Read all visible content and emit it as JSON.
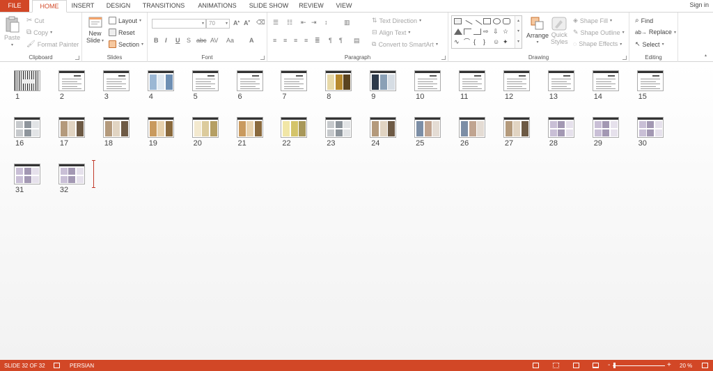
{
  "tabs": [
    "FILE",
    "HOME",
    "INSERT",
    "DESIGN",
    "TRANSITIONS",
    "ANIMATIONS",
    "SLIDE SHOW",
    "REVIEW",
    "VIEW"
  ],
  "active_tab": "HOME",
  "signin": "Sign in",
  "ribbon": {
    "clipboard": {
      "label": "Clipboard",
      "paste": "Paste",
      "cut": "Cut",
      "copy": "Copy",
      "format_painter": "Format Painter"
    },
    "slides": {
      "label": "Slides",
      "new_slide_1": "New",
      "new_slide_2": "Slide",
      "layout": "Layout",
      "reset": "Reset",
      "section": "Section"
    },
    "font": {
      "label": "Font",
      "font_size": "70"
    },
    "paragraph": {
      "label": "Paragraph",
      "text_direction": "Text Direction",
      "align_text": "Align Text",
      "convert_smartart": "Convert to SmartArt"
    },
    "drawing": {
      "label": "Drawing",
      "arrange": "Arrange",
      "quick_styles_1": "Quick",
      "quick_styles_2": "Styles",
      "shape_fill": "Shape Fill",
      "shape_outline": "Shape Outline",
      "shape_effects": "Shape Effects"
    },
    "editing": {
      "label": "Editing",
      "find": "Find",
      "replace": "Replace",
      "select": "Select"
    }
  },
  "slides": [
    {
      "n": "1",
      "kind": "pattern"
    },
    {
      "n": "2",
      "kind": "text"
    },
    {
      "n": "3",
      "kind": "text"
    },
    {
      "n": "4",
      "kind": "photo-blue"
    },
    {
      "n": "5",
      "kind": "text"
    },
    {
      "n": "6",
      "kind": "text"
    },
    {
      "n": "7",
      "kind": "text"
    },
    {
      "n": "8",
      "kind": "photo-gold"
    },
    {
      "n": "9",
      "kind": "photo-dark"
    },
    {
      "n": "10",
      "kind": "text"
    },
    {
      "n": "11",
      "kind": "text"
    },
    {
      "n": "12",
      "kind": "text"
    },
    {
      "n": "13",
      "kind": "text"
    },
    {
      "n": "14",
      "kind": "text"
    },
    {
      "n": "15",
      "kind": "text"
    },
    {
      "n": "16",
      "kind": "photo-grid"
    },
    {
      "n": "17",
      "kind": "photo-room"
    },
    {
      "n": "18",
      "kind": "photo-room"
    },
    {
      "n": "19",
      "kind": "photo-warm"
    },
    {
      "n": "20",
      "kind": "photo-plan"
    },
    {
      "n": "21",
      "kind": "photo-warm"
    },
    {
      "n": "22",
      "kind": "photo-yellow"
    },
    {
      "n": "23",
      "kind": "photo-grid"
    },
    {
      "n": "24",
      "kind": "photo-room"
    },
    {
      "n": "25",
      "kind": "photo-mixed"
    },
    {
      "n": "26",
      "kind": "photo-mixed"
    },
    {
      "n": "27",
      "kind": "photo-room"
    },
    {
      "n": "28",
      "kind": "photo-lilac"
    },
    {
      "n": "29",
      "kind": "photo-lilac"
    },
    {
      "n": "30",
      "kind": "photo-lilac"
    },
    {
      "n": "31",
      "kind": "photo-lilac"
    },
    {
      "n": "32",
      "kind": "photo-lilac"
    }
  ],
  "status": {
    "slide_info": "SLIDE 32 OF 32",
    "language": "PERSIAN",
    "zoom": "20 %",
    "zoom_minus": "-",
    "zoom_plus": "+"
  },
  "colors": {
    "accent": "#d24726"
  }
}
